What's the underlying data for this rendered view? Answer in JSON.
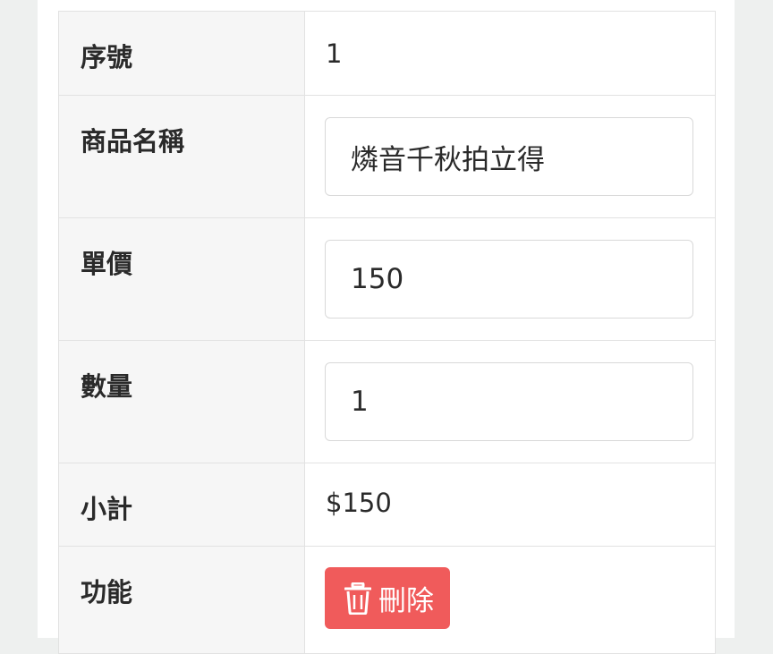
{
  "rows": [
    {
      "label": "序號",
      "value": "1"
    },
    {
      "label": "商品名稱",
      "value": "燐音千秋拍立得"
    },
    {
      "label": "單價",
      "value": "150"
    },
    {
      "label": "數量",
      "value": "1"
    },
    {
      "label": "小計",
      "value": "$150"
    },
    {
      "label": "功能",
      "button_label": "刪除",
      "button_icon": "trash-icon"
    }
  ],
  "colors": {
    "delete_button": "#f05b5b",
    "label_background": "#f6f6f6",
    "page_background": "#eef0ef"
  }
}
